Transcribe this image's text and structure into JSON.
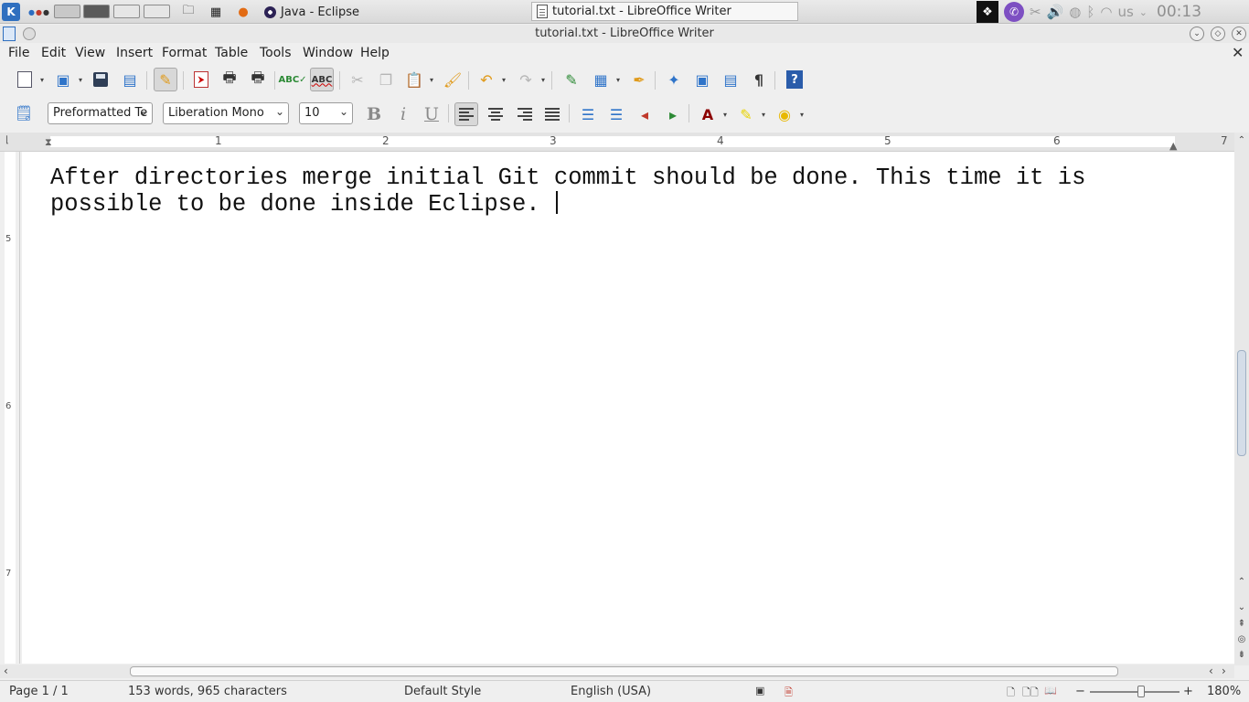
{
  "taskbar": {
    "launcher_glyph": "K",
    "tasks": [
      {
        "label": "Java - Eclipse"
      },
      {
        "label": "tutorial.txt - LibreOffice Writer"
      }
    ],
    "tray": {
      "keyboard_layout": "us",
      "clock": "00:13"
    }
  },
  "window": {
    "title": "tutorial.txt - LibreOffice Writer"
  },
  "menu": [
    "File",
    "Edit",
    "View",
    "Insert",
    "Format",
    "Table",
    "Tools",
    "Window",
    "Help"
  ],
  "formatting": {
    "paragraph_style": "Preformatted Te",
    "font_name": "Liberation Mono",
    "font_size": "10",
    "bold_glyph": "B",
    "italic_glyph": "i",
    "underline_glyph": "U"
  },
  "ruler": {
    "h_numbers": [
      "1",
      "2",
      "3",
      "4",
      "5",
      "6",
      "7"
    ],
    "v_numbers": [
      "5",
      "6",
      "7"
    ]
  },
  "document": {
    "text": "After directories merge initial Git commit should be done. This time it is possible to be done inside Eclipse. "
  },
  "status": {
    "page": "Page 1 / 1",
    "word_count": "153 words, 965 characters",
    "page_style": "Default Style",
    "language": "English (USA)",
    "zoom": "180%",
    "zoom_level_fraction": 0.54
  },
  "icons": {
    "accent": "#2f74c9",
    "undo": "#e09a1a"
  }
}
